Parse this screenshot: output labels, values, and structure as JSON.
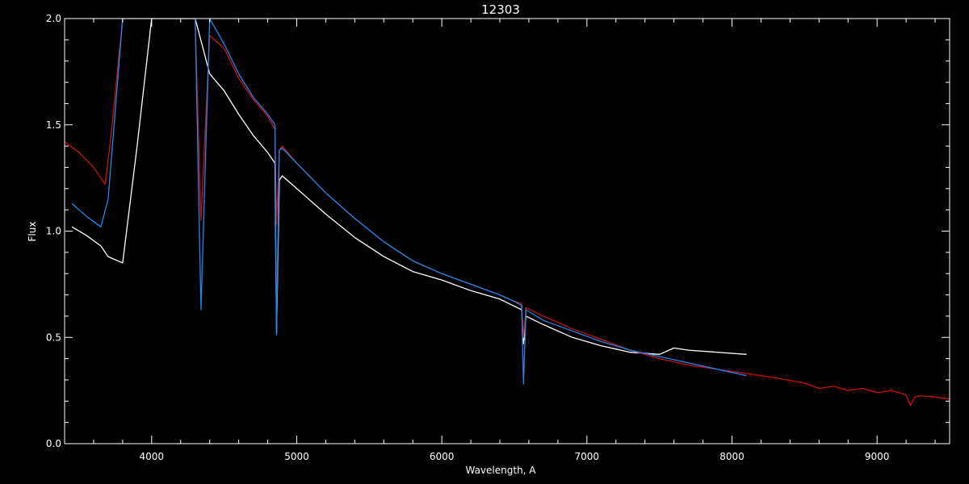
{
  "chart_data": {
    "type": "line",
    "title": "12303",
    "xlabel": "Wavelength, A",
    "ylabel": "Flux",
    "xlim": [
      3400,
      9500
    ],
    "ylim": [
      0.0,
      2.0
    ],
    "x_ticks": [
      4000,
      5000,
      6000,
      7000,
      8000,
      9000
    ],
    "x_tick_labels": [
      "4000",
      "5000",
      "6000",
      "7000",
      "8000",
      "9000"
    ],
    "y_ticks": [
      0.0,
      0.5,
      1.0,
      1.5,
      2.0
    ],
    "y_tick_labels": [
      "0.0",
      "0.5",
      "1.0",
      "1.5",
      "2.0"
    ],
    "grid": false,
    "background": "#000000",
    "axis_color": "#ffffff",
    "series": [
      {
        "color": "#ffffff",
        "x": [
          3450,
          3550,
          3650,
          3700,
          3800,
          3900,
          4000,
          4100,
          4200,
          4300,
          4400,
          4500,
          4600,
          4700,
          4800,
          4850,
          4861,
          4880,
          4900,
          5000,
          5200,
          5400,
          5600,
          5800,
          6000,
          6200,
          6400,
          6550,
          6563,
          6580,
          6700,
          6900,
          7100,
          7300,
          7500,
          7600,
          7700,
          7900,
          8100
        ],
        "y": [
          1.02,
          0.98,
          0.93,
          0.88,
          0.85,
          1.4,
          2.0,
          2.0,
          2.0,
          2.0,
          1.74,
          1.66,
          1.55,
          1.45,
          1.37,
          1.32,
          0.52,
          1.24,
          1.26,
          1.2,
          1.08,
          0.97,
          0.88,
          0.81,
          0.77,
          0.72,
          0.68,
          0.63,
          0.47,
          0.6,
          0.56,
          0.5,
          0.46,
          0.43,
          0.42,
          0.45,
          0.44,
          0.43,
          0.42
        ]
      },
      {
        "color": "#cc1111",
        "x": [
          3400,
          3500,
          3600,
          3680,
          3720,
          3800,
          3900,
          4000,
          4100,
          4200,
          4300,
          4340,
          4400,
          4500,
          4600,
          4700,
          4800,
          4850,
          4861,
          4880,
          4900,
          5000,
          5200,
          5400,
          5600,
          5800,
          6000,
          6200,
          6400,
          6500,
          6550,
          6563,
          6580,
          6700,
          6900,
          7100,
          7300,
          7500,
          7700,
          7900,
          8100,
          8300,
          8500,
          8600,
          8700,
          8800,
          8900,
          9000,
          9100,
          9200,
          9230,
          9260,
          9300,
          9400,
          9500
        ],
        "y": [
          1.42,
          1.37,
          1.3,
          1.22,
          1.45,
          2.0,
          2.0,
          2.0,
          2.0,
          2.0,
          2.0,
          1.05,
          1.92,
          1.86,
          1.72,
          1.62,
          1.54,
          1.48,
          1.03,
          1.38,
          1.4,
          1.32,
          1.18,
          1.06,
          0.95,
          0.86,
          0.8,
          0.75,
          0.7,
          0.67,
          0.66,
          0.5,
          0.64,
          0.6,
          0.54,
          0.49,
          0.44,
          0.4,
          0.37,
          0.35,
          0.33,
          0.31,
          0.285,
          0.26,
          0.27,
          0.25,
          0.26,
          0.24,
          0.25,
          0.23,
          0.18,
          0.22,
          0.225,
          0.22,
          0.21
        ]
      },
      {
        "color": "#1e88ee",
        "x": [
          3450,
          3550,
          3650,
          3700,
          3800,
          3900,
          4000,
          4100,
          4200,
          4300,
          4340,
          4400,
          4500,
          4600,
          4700,
          4800,
          4850,
          4861,
          4880,
          4900,
          5000,
          5200,
          5400,
          5600,
          5800,
          6000,
          6200,
          6400,
          6500,
          6550,
          6563,
          6580,
          6700,
          6900,
          7100,
          7300,
          7500,
          7700,
          7900,
          8100
        ],
        "y": [
          1.13,
          1.07,
          1.02,
          1.15,
          2.0,
          2.0,
          2.0,
          2.0,
          2.0,
          2.0,
          0.63,
          2.0,
          1.88,
          1.74,
          1.63,
          1.55,
          1.5,
          0.51,
          1.38,
          1.39,
          1.32,
          1.18,
          1.06,
          0.95,
          0.86,
          0.8,
          0.75,
          0.7,
          0.67,
          0.65,
          0.28,
          0.63,
          0.58,
          0.53,
          0.48,
          0.44,
          0.41,
          0.38,
          0.35,
          0.32
        ]
      }
    ]
  }
}
